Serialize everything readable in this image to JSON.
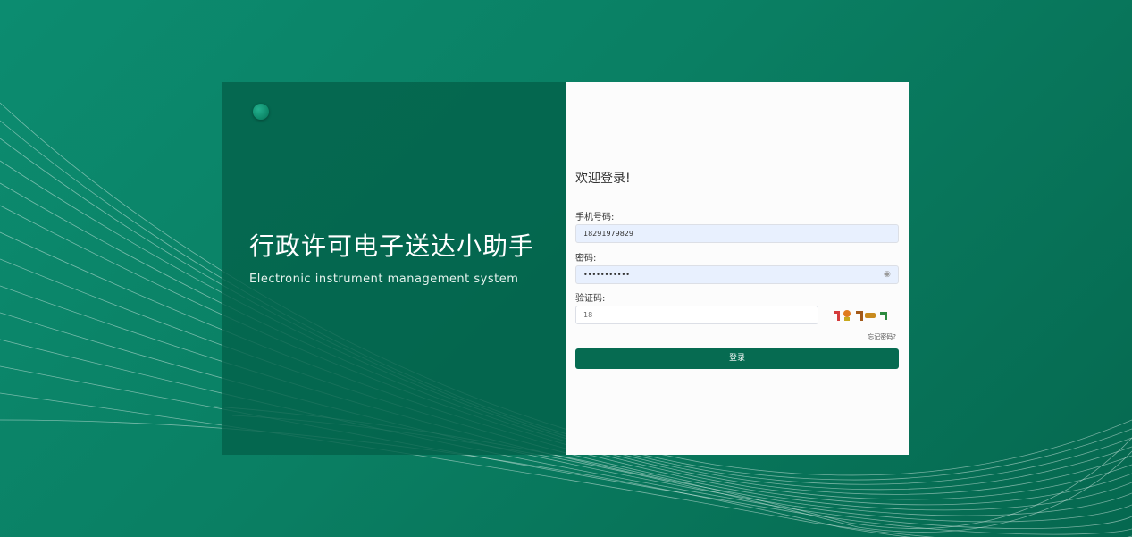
{
  "brand": {
    "title": "行政许可电子送达小助手",
    "subtitle": "Electronic instrument management system"
  },
  "login": {
    "welcome": "欢迎登录!",
    "phone_label": "手机号码:",
    "phone_value": "18291979829",
    "password_label": "密码:",
    "password_value": "•••••••••••",
    "captcha_label": "验证码:",
    "captcha_value": "18",
    "forgot_label": "忘记密码?",
    "login_button": "登录"
  },
  "colors": {
    "background": "#0a7f63",
    "panel_dark": "#05684f",
    "button": "#066b51",
    "input_autofill": "#e8f0fe"
  },
  "icons": {
    "password_toggle": "eye-icon",
    "decor": "circle-dot-icon"
  }
}
